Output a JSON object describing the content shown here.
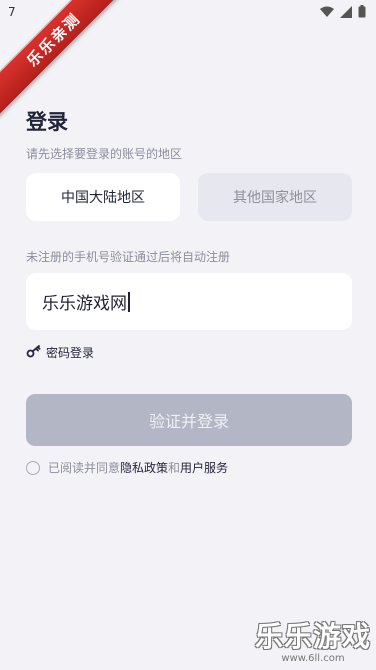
{
  "status_bar": {
    "time": "7"
  },
  "ribbon": {
    "text": "乐乐亲测"
  },
  "login": {
    "title": "登录",
    "region_prompt": "请先选择要登录的账号的地区",
    "regions": [
      {
        "label": "中国大陆地区",
        "selected": true
      },
      {
        "label": "其他国家地区",
        "selected": false
      }
    ],
    "hint": "未注册的手机号验证通过后将自动注册",
    "phone_input": {
      "value": "乐乐游戏网"
    },
    "password_login": "密码登录",
    "submit": "验证并登录",
    "agreement": {
      "prefix": "已阅读并同意 ",
      "privacy": "隐私政策",
      "and": "和",
      "terms": "用户服务"
    }
  },
  "watermark": {
    "logo": "乐乐游戏",
    "url": "www.6ll.com"
  },
  "colors": {
    "background": "#f3f3f7",
    "submit_disabled": "#b3b6c4",
    "ribbon": "#c82a25"
  }
}
